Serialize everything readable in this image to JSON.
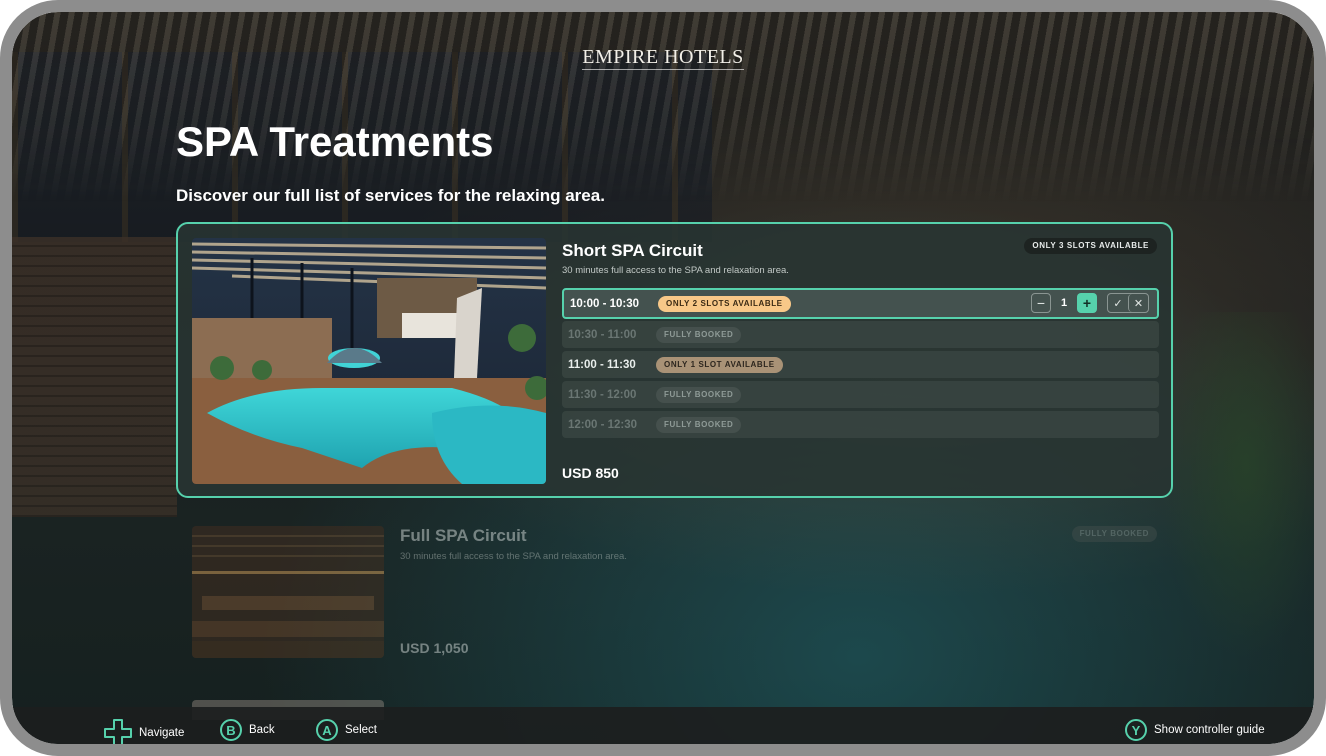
{
  "brand": {
    "logo_text": "EMPIRE HOTELS"
  },
  "page": {
    "title": "SPA Treatments",
    "subtitle": "Discover our full list of services for the relaxing area."
  },
  "selected_card": {
    "name": "Short SPA Circuit",
    "description": "30 minutes full access to the SPA and relaxation area.",
    "availability_badge": "ONLY 3 SLOTS AVAILABLE",
    "price": "USD 850",
    "slots": [
      {
        "time": "10:00 - 10:30",
        "status": "ONLY 2 SLOTS AVAILABLE"
      },
      {
        "time": "10:30 - 11:00",
        "status": "FULLY BOOKED"
      },
      {
        "time": "11:00 - 11:30",
        "status": "ONLY 1 SLOT AVAILABLE"
      },
      {
        "time": "11:30 - 12:00",
        "status": "FULLY BOOKED"
      },
      {
        "time": "12:00 - 12:30",
        "status": "FULLY BOOKED"
      }
    ],
    "quantity": "1",
    "icons": {
      "decrement": "minus-icon",
      "increment": "plus-icon",
      "confirm": "check-icon",
      "cancel": "close-icon"
    }
  },
  "next_card": {
    "name": "Full SPA Circuit",
    "description": "30 minutes full access to the SPA and relaxation area.",
    "availability_badge": "FULLY BOOKED",
    "price": "USD 1,050"
  },
  "footer": {
    "navigate": {
      "label": "Navigate",
      "icon": "dpad-icon"
    },
    "back": {
      "label": "Back",
      "button": "B"
    },
    "select": {
      "label": "Select",
      "button": "A"
    },
    "guide": {
      "label": "Show controller guide",
      "button": "Y"
    }
  },
  "colors": {
    "accent": "#56d1ac",
    "badge_amber": "#f8c888",
    "card_bg": "#28342f"
  }
}
